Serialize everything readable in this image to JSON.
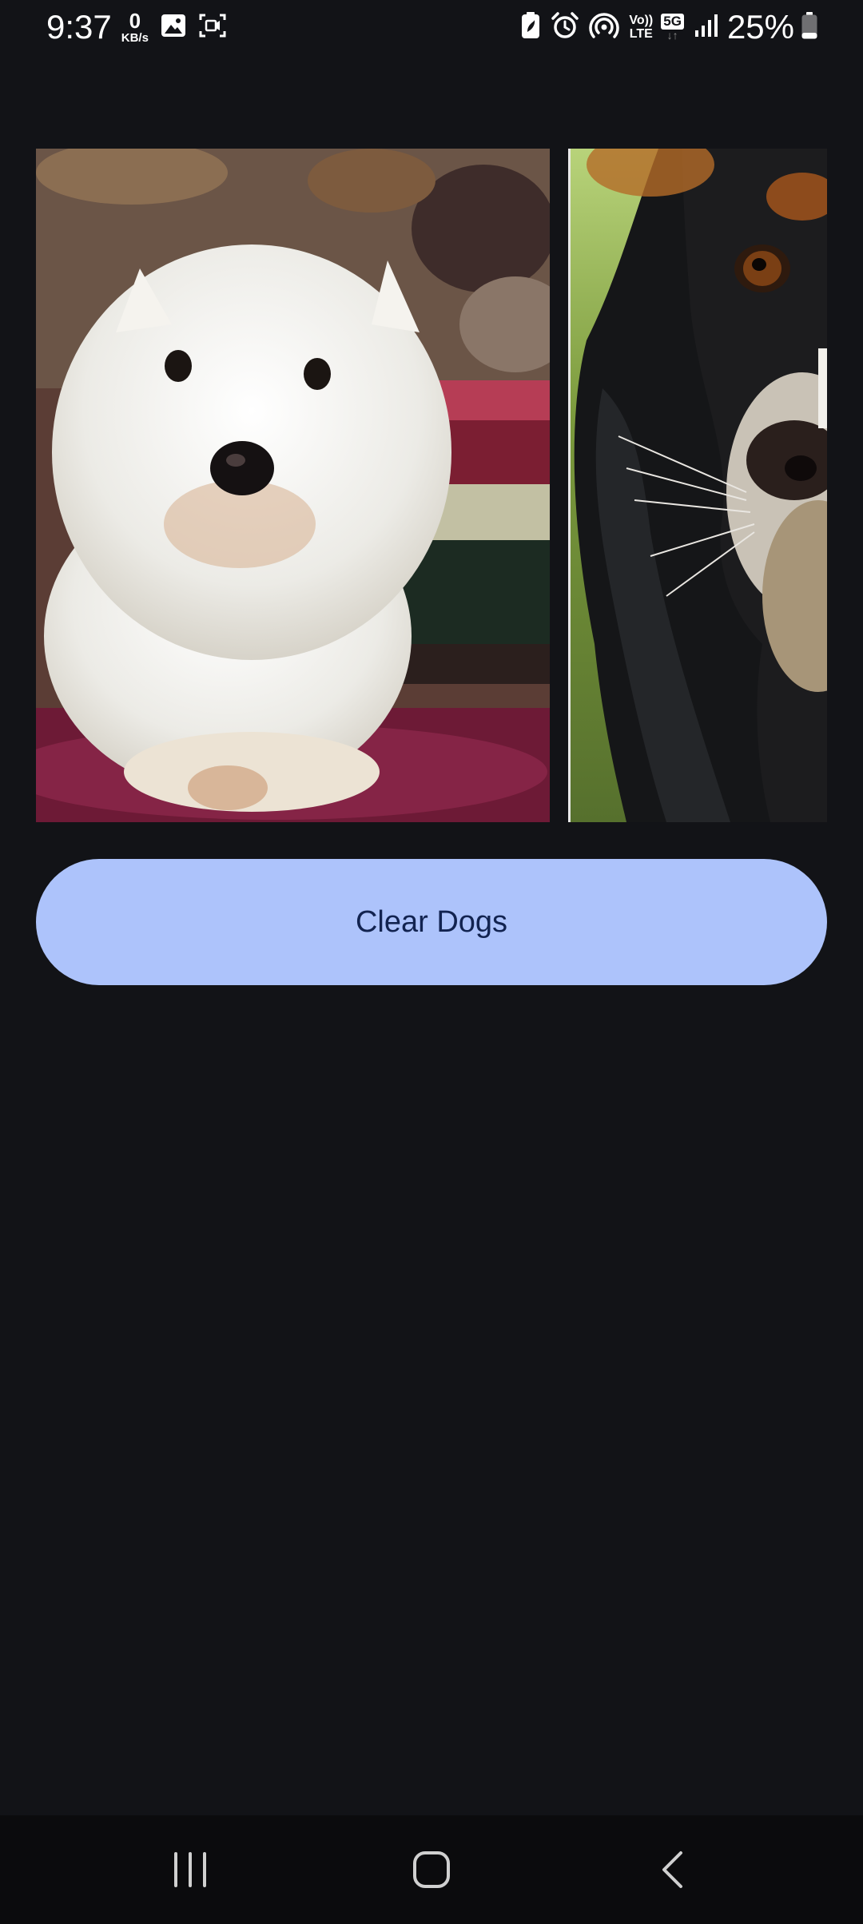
{
  "status_bar": {
    "time": "9:37",
    "net_speed_value": "0",
    "net_speed_unit": "KB/s",
    "volte_top": "Vo))",
    "volte_bottom": "LTE",
    "network_type": "5G",
    "network_arrows": "↓↑",
    "battery_percent": "25%",
    "battery_level": 0.25,
    "icons_left": [
      "image-notification-icon",
      "screen-recorder-icon"
    ],
    "icons_right": [
      "battery-saver-icon",
      "alarm-icon",
      "hotspot-icon",
      "volte-icon",
      "5g-icon",
      "signal-icon",
      "battery-icon"
    ]
  },
  "dogs": [
    {
      "name": "dog-image-westie",
      "description_icon": "white-terrier-photo"
    },
    {
      "name": "dog-image-spaniel",
      "description_icon": "black-spaniel-photo"
    }
  ],
  "clear_button": {
    "label": "Clear Dogs",
    "background_color": "#adc3fb",
    "text_color": "#122350"
  },
  "nav_bar": {
    "buttons": [
      "recents-icon",
      "home-icon",
      "back-icon"
    ]
  },
  "theme": {
    "background": "#121317",
    "nav_background": "#0b0b0d"
  }
}
